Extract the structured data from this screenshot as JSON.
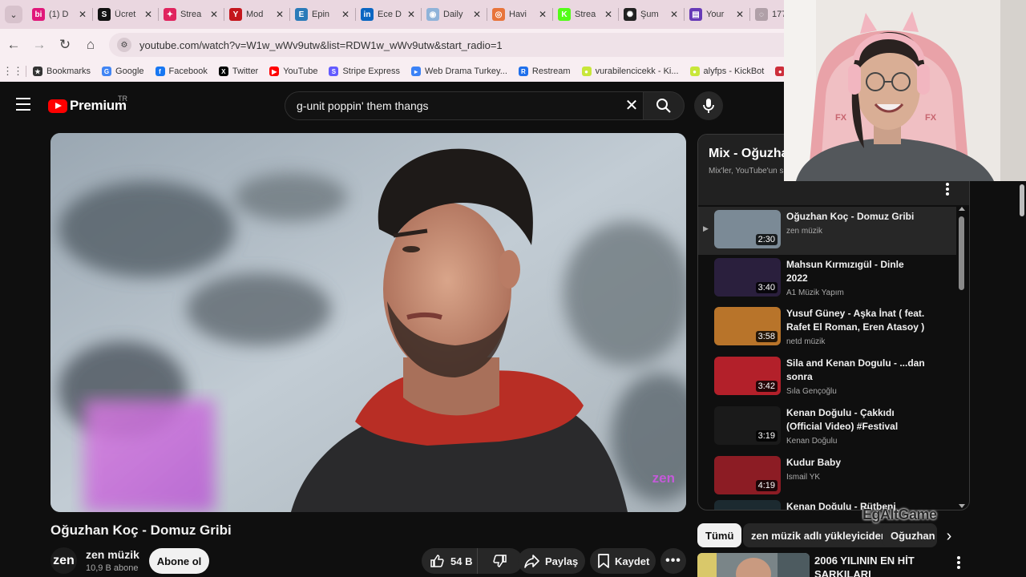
{
  "browser": {
    "tabs": [
      {
        "label": "(1) D",
        "icon": "bi-icon",
        "color": "#e0187a",
        "glyph": "bi"
      },
      {
        "label": "Ücret",
        "icon": "stripe-s-icon",
        "color": "#111111",
        "glyph": "S"
      },
      {
        "label": "Strea",
        "icon": "streamlabs-icon",
        "color": "#e0245e",
        "glyph": "✦"
      },
      {
        "label": "Mod",
        "icon": "y-icon",
        "color": "#c4161c",
        "glyph": "Y"
      },
      {
        "label": "Epin",
        "icon": "epin-icon",
        "color": "#2b7bb9",
        "glyph": "E"
      },
      {
        "label": "Ece D",
        "icon": "linkedin-icon",
        "color": "#0a66c2",
        "glyph": "in"
      },
      {
        "label": "Daily",
        "icon": "daily-icon",
        "color": "#8fb3d9",
        "glyph": "◉"
      },
      {
        "label": "Havi",
        "icon": "havi-icon",
        "color": "#e8743b",
        "glyph": "◎"
      },
      {
        "label": "Strea",
        "icon": "kick-icon",
        "color": "#53fc18",
        "glyph": "K"
      },
      {
        "label": "Şum",
        "icon": "chatgpt-icon",
        "color": "#222222",
        "glyph": "✺"
      },
      {
        "label": "Your",
        "icon": "forms-icon",
        "color": "#673ab7",
        "glyph": "▤"
      },
      {
        "label": "1770",
        "icon": "globe-icon",
        "color": "#b0a0a8",
        "glyph": "◌"
      }
    ],
    "url": "youtube.com/watch?v=W1w_wWv9utw&list=RDW1w_wWv9utw&start_radio=1",
    "bookmarks": [
      {
        "label": "Bookmarks",
        "icon": "star-icon",
        "color": "#333333",
        "glyph": "★"
      },
      {
        "label": "Google",
        "icon": "google-icon",
        "color": "#4285f4",
        "glyph": "G"
      },
      {
        "label": "Facebook",
        "icon": "facebook-icon",
        "color": "#1877f2",
        "glyph": "f"
      },
      {
        "label": "Twitter",
        "icon": "x-icon",
        "color": "#000000",
        "glyph": "X"
      },
      {
        "label": "YouTube",
        "icon": "youtube-icon",
        "color": "#ff0000",
        "glyph": "▶"
      },
      {
        "label": "Stripe Express",
        "icon": "stripe-icon",
        "color": "#635bff",
        "glyph": "S"
      },
      {
        "label": "Web Drama Turkey...",
        "icon": "drama-icon",
        "color": "#3b82f6",
        "glyph": "▸"
      },
      {
        "label": "Restream",
        "icon": "restream-icon",
        "color": "#1f6feb",
        "glyph": "R"
      },
      {
        "label": "vurabilencicekk - Ki...",
        "icon": "kick-icon",
        "color": "#c8e63a",
        "glyph": "●"
      },
      {
        "label": "alyfps - KickBot",
        "icon": "kickbot-icon",
        "color": "#c8e63a",
        "glyph": "●"
      },
      {
        "label": "Korean Vi",
        "icon": "korea-flag-icon",
        "color": "#cd2e3a",
        "glyph": "●"
      }
    ]
  },
  "youtube": {
    "logo_text": "Premium",
    "region": "TR",
    "search_query": "g-unit poppin' them thangs",
    "video": {
      "title": "Oğuzhan Koç - Domuz Gribi",
      "watermark": "zen",
      "channel_avatar": "zen",
      "channel_name": "zen müzik",
      "subscribers": "10,9 B abone",
      "subscribe_label": "Abone ol",
      "likes": "54 B",
      "share_label": "Paylaş",
      "save_label": "Kaydet"
    },
    "playlist": {
      "title": "Mix - Oğuzha",
      "subtitle": "Mix'ler, YouTube'un si",
      "items": [
        {
          "title": "Oğuzhan Koç - Domuz Gribi",
          "channel": "zen müzik",
          "duration": "2:30",
          "active": true,
          "thumb_color": "#7b8a96"
        },
        {
          "title": "Mahsun Kırmızıgül - Dinle 2022",
          "channel": "A1 Müzik Yapım",
          "duration": "3:40",
          "active": false,
          "thumb_color": "#2a1f3d"
        },
        {
          "title": "Yusuf Güney - Aşka İnat ( feat. Rafet El Roman, Eren Atasoy )",
          "channel": "netd müzik",
          "duration": "3:58",
          "active": false,
          "thumb_color": "#b8742a"
        },
        {
          "title": "Sila and Kenan Dogulu - ...dan sonra",
          "channel": "Sıla Gençoğlu",
          "duration": "3:42",
          "active": false,
          "thumb_color": "#b3202a"
        },
        {
          "title": "Kenan Doğulu - Çakkıdı (Official Video) #Festival",
          "channel": "Kenan Doğulu",
          "duration": "3:19",
          "active": false,
          "thumb_color": "#1a1a1a"
        },
        {
          "title": "Kudur Baby",
          "channel": "Ismail YK",
          "duration": "4:19",
          "active": false,
          "thumb_color": "#8c1c24"
        },
        {
          "title": "Kenan Doğulu - Rütbeni",
          "channel": "",
          "duration": "",
          "active": false,
          "thumb_color": "#1c2a30"
        }
      ]
    },
    "chips": [
      "Tümü",
      "zen müzik adlı yükleyiciden",
      "Oğuzhan"
    ],
    "recommendation": {
      "title": "2006 YILININ EN HİT ŞARKILARI"
    }
  },
  "overlay": {
    "brand": "EgAltGame"
  }
}
